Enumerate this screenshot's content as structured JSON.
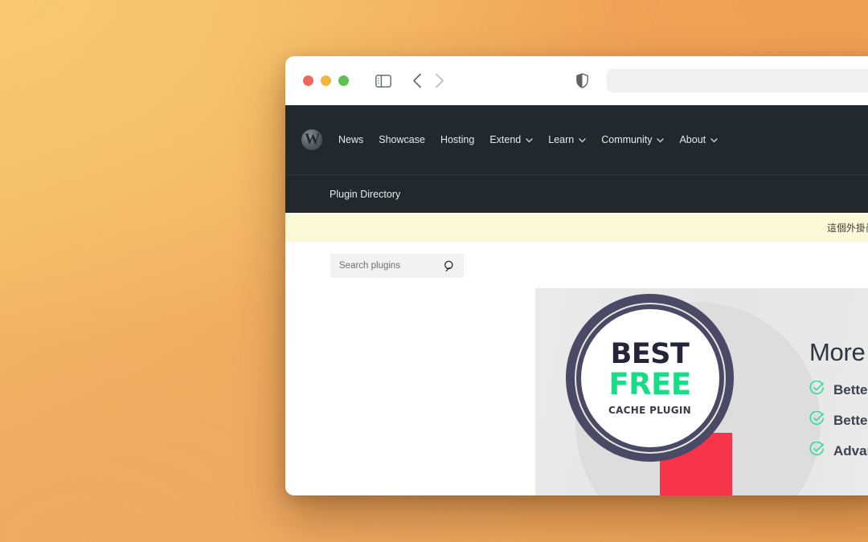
{
  "browser": {
    "traffic_lights": [
      "close",
      "minimize",
      "zoom"
    ],
    "sidebar_toggle_icon": "sidebar-toggle-icon",
    "back_icon": "chevron-left-icon",
    "forward_icon": "chevron-right-icon",
    "shield_icon": "shield-icon",
    "address_value": "",
    "address_placeholder": ""
  },
  "site_header": {
    "logo_glyph": "W",
    "nav": [
      {
        "label": "News",
        "has_caret": false
      },
      {
        "label": "Showcase",
        "has_caret": false
      },
      {
        "label": "Hosting",
        "has_caret": false
      },
      {
        "label": "Extend",
        "has_caret": true
      },
      {
        "label": "Learn",
        "has_caret": true
      },
      {
        "label": "Community",
        "has_caret": true
      },
      {
        "label": "About",
        "has_caret": true
      }
    ],
    "breadcrumb": "Plugin Directory"
  },
  "notice": {
    "text": "這個外掛尚無繁體中文本地化版本"
  },
  "search": {
    "value": "",
    "placeholder": "Search plugins",
    "icon": "search-icon"
  },
  "banner": {
    "badge": {
      "line1": "BEST",
      "line2": "FREE",
      "line3": "CACHE PLUGIN"
    },
    "heading": "More",
    "features": [
      {
        "label": "Better"
      },
      {
        "label": "Better"
      },
      {
        "label": "Advan"
      }
    ]
  },
  "colors": {
    "wp_dark": "#23282d",
    "notice_bg": "#fcf9d9",
    "badge_green": "#17dd86",
    "ribbon_red": "#f8344a",
    "check_green": "#3ed99f"
  }
}
